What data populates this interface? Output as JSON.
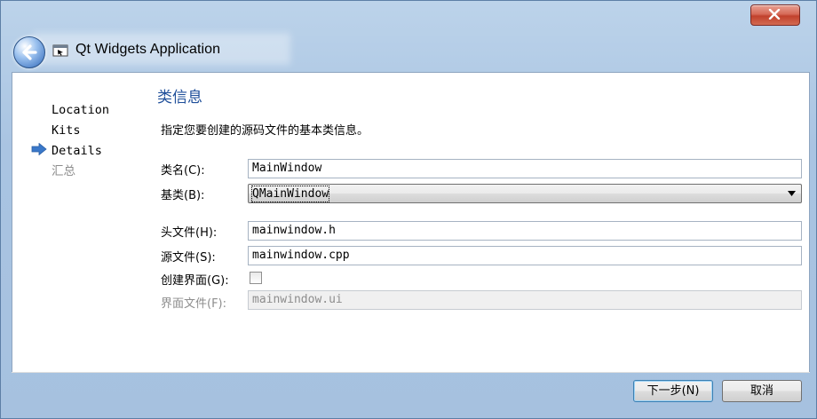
{
  "window": {
    "title": "Qt Widgets Application",
    "close_icon": "close-icon",
    "back_icon": "back-arrow-icon"
  },
  "steps": [
    {
      "label": "Location",
      "active": false,
      "done": true
    },
    {
      "label": "Kits",
      "active": false,
      "done": true
    },
    {
      "label": "Details",
      "active": true,
      "done": false
    },
    {
      "label": "汇总",
      "active": false,
      "done": false
    }
  ],
  "page": {
    "title": "类信息",
    "description": "指定您要创建的源码文件的基本类信息。"
  },
  "form": {
    "class_name_label": "类名(C):",
    "class_name_value": "MainWindow",
    "base_class_label": "基类(B):",
    "base_class_value": "QMainWindow",
    "header_label": "头文件(H):",
    "header_value": "mainwindow.h",
    "source_label": "源文件(S):",
    "source_value": "mainwindow.cpp",
    "create_form_label": "创建界面(G):",
    "create_form_checked": false,
    "form_file_label": "界面文件(F):",
    "form_file_value": "mainwindow.ui"
  },
  "buttons": {
    "next": "下一步(N)",
    "cancel": "取消"
  },
  "colors": {
    "accent": "#1f4f9a",
    "step_arrow": "#3a78c9",
    "disabled_text": "#8d8d8d"
  }
}
